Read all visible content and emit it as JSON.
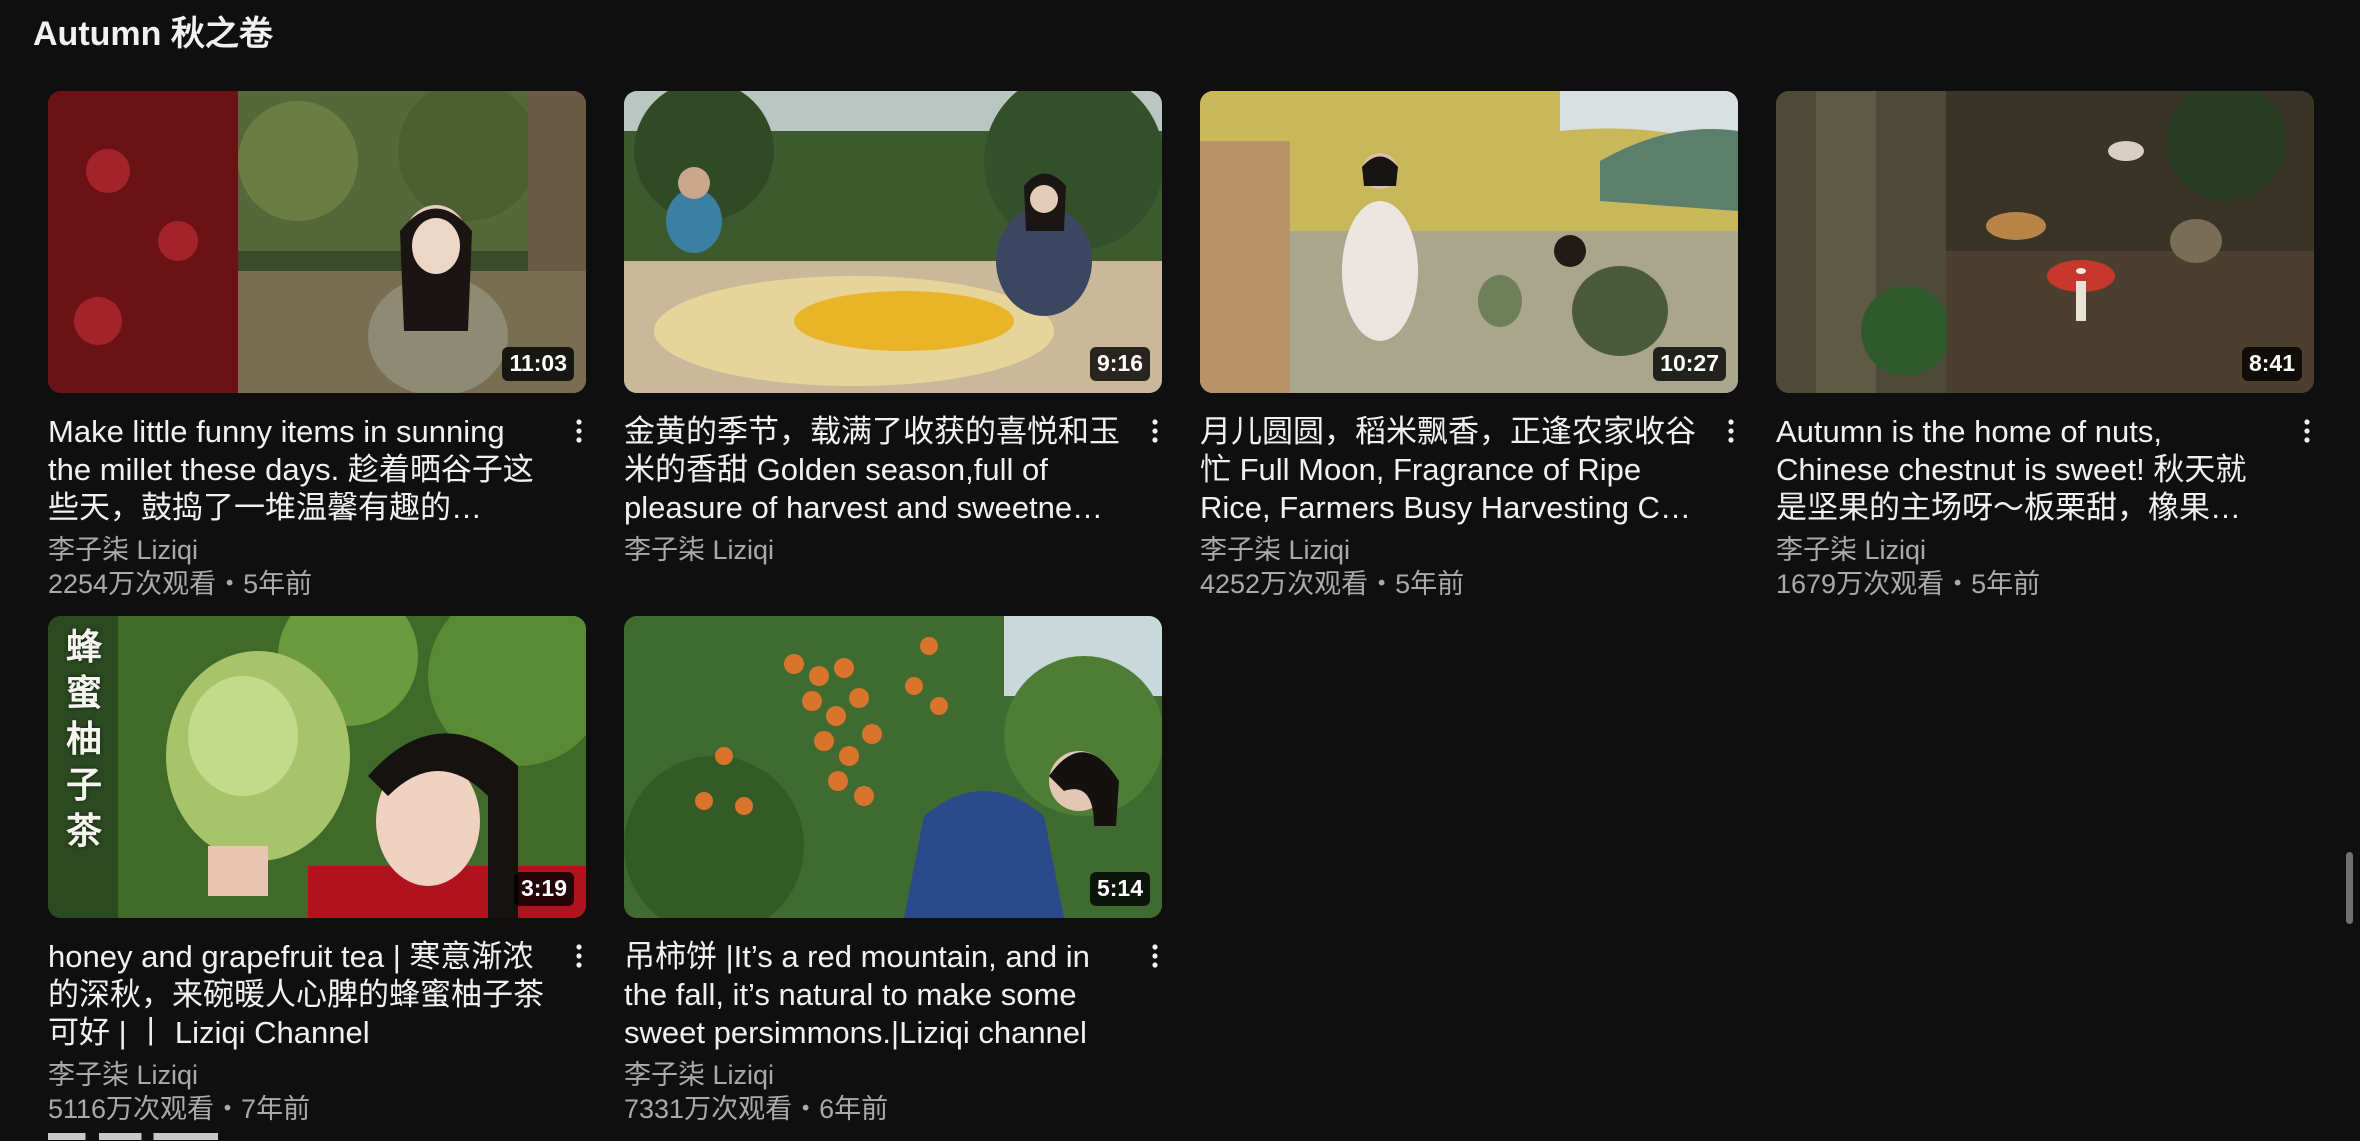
{
  "section": {
    "title": "Autumn 秋之卷"
  },
  "videos": [
    {
      "title": "Make little funny items in sunning the millet these days. 趁着晒谷子这些天，鼓捣了一堆温馨有趣的…",
      "duration": "11:03",
      "channel": "李子柒 Liziqi",
      "stats": "2254万次观看・5年前"
    },
    {
      "title": "金黄的季节，载满了收获的喜悦和玉米的香甜 Golden season,full of pleasure of harvest and sweetne…",
      "duration": "9:16",
      "channel": "李子柒 Liziqi",
      "stats": ""
    },
    {
      "title": "月儿圆圆，稻米飘香，正逢农家收谷忙 Full Moon, Fragrance of Ripe Rice, Farmers Busy Harvesting C…",
      "duration": "10:27",
      "channel": "李子柒 Liziqi",
      "stats": "4252万次观看・5年前"
    },
    {
      "title": "Autumn is the home of nuts, Chinese chestnut is sweet! 秋天就是坚果的主场呀～板栗甜，橡果…",
      "duration": "8:41",
      "channel": "李子柒 Liziqi",
      "stats": "1679万次观看・5年前"
    },
    {
      "title": "honey and grapefruit tea | 寒意渐浓的深秋，来碗暖人心脾的蜂蜜柚子茶可好 | 丨 Liziqi Channel",
      "duration": "3:19",
      "channel": "李子柒 Liziqi",
      "stats": "5116万次观看・7年前",
      "overlay": "蜂蜜柚子茶"
    },
    {
      "title": "吊柿饼 |It’s a red mountain, and in the fall, it’s natural to make some sweet persimmons.|Liziqi channel",
      "duration": "5:14",
      "channel": "李子柒 Liziqi",
      "stats": "7331万次观看・6年前"
    }
  ],
  "icons": {
    "more": "more-vert-icon"
  },
  "colors": {
    "background": "#0f0f0f",
    "title": "#f1f1f1",
    "secondary": "#aaaaaa"
  }
}
